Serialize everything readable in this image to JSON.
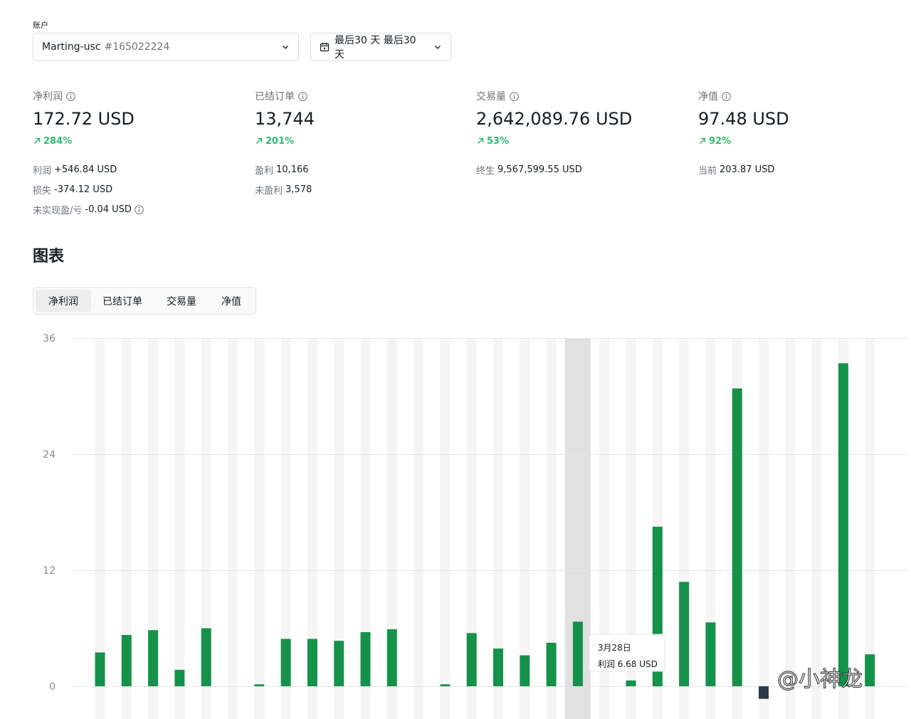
{
  "account": {
    "label": "账户",
    "name": "Marting-usc",
    "id": "#165022224"
  },
  "date_range": {
    "label": "最后30 天 最后30 天"
  },
  "stats": [
    {
      "title": "净利润",
      "value": "172.72 USD",
      "change": "284%",
      "details": [
        {
          "label": "利润",
          "value": "+546.84 USD"
        },
        {
          "label": "损失",
          "value": "-374.12 USD"
        },
        {
          "label": "未实现盈/亏",
          "value": "-0.04 USD"
        }
      ]
    },
    {
      "title": "已结订单",
      "value": "13,744",
      "change": "201%",
      "details": [
        {
          "label": "盈利",
          "value": "10,166"
        },
        {
          "label": "未盈利",
          "value": "3,578"
        }
      ]
    },
    {
      "title": "交易量",
      "value": "2,642,089.76 USD",
      "change": "53%",
      "details": [
        {
          "label": "终生",
          "value": "9,567,599.55 USD"
        }
      ]
    },
    {
      "title": "净值",
      "value": "97.48 USD",
      "change": "92%",
      "details": [
        {
          "label": "当前",
          "value": "203.87 USD"
        }
      ]
    }
  ],
  "charts_section": {
    "title": "图表",
    "tabs": [
      "净利润",
      "已结订单",
      "交易量",
      "净值"
    ],
    "active_tab": 0
  },
  "tooltip": {
    "date": "3月28日",
    "label": "利润",
    "value": "6.68 USD"
  },
  "watermark": "@小神龙",
  "colors": {
    "positive": "#16914a",
    "negative": "#2a3a48",
    "accent_green": "#2eb872"
  },
  "chart_data": {
    "type": "bar",
    "ylim": [
      0,
      36
    ],
    "yticks": [
      0,
      12,
      24,
      36
    ],
    "highlight_index": 18,
    "values": [
      3.5,
      5.3,
      5.8,
      1.7,
      6.0,
      null,
      0.2,
      4.9,
      4.9,
      4.7,
      5.6,
      5.9,
      null,
      0.2,
      5.5,
      3.9,
      3.2,
      4.5,
      6.68,
      null,
      0.6,
      16.5,
      10.8,
      6.6,
      30.8,
      -1.3,
      null,
      null,
      33.4,
      3.3
    ]
  }
}
